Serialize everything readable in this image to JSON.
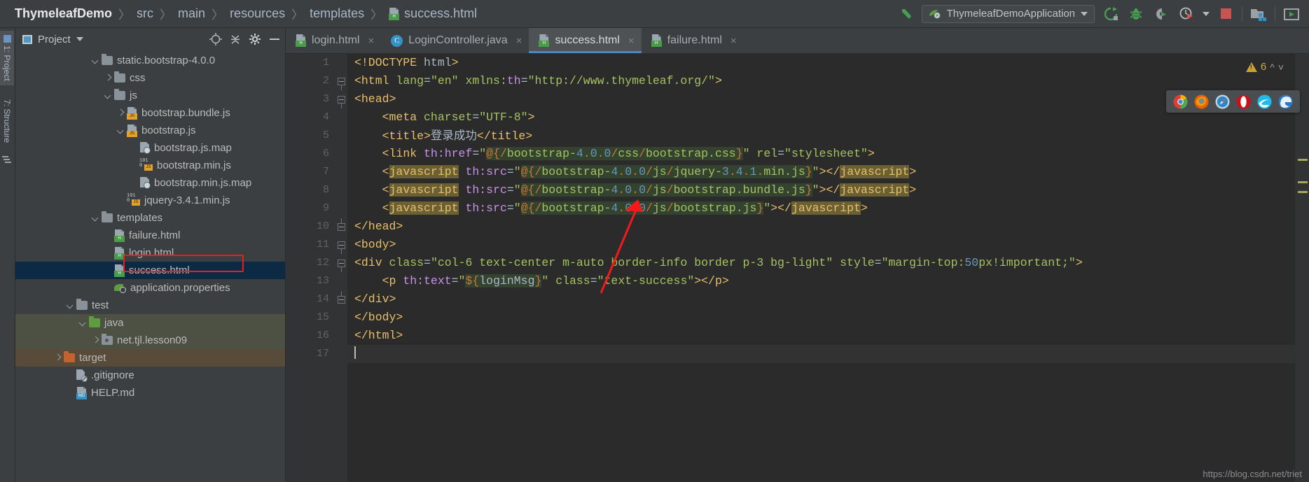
{
  "breadcrumb": {
    "project": "ThymeleafDemo",
    "items": [
      "src",
      "main",
      "resources",
      "templates"
    ],
    "file": "success.html",
    "separator": "〉"
  },
  "toolbar": {
    "back_icon": "back-arrow-icon",
    "run_config": "ThymeleafDemoApplication",
    "icons": [
      "rerun-icon",
      "debug-icon",
      "run-with-coverage-icon",
      "profiler-icon",
      "stop-icon",
      "project-structure-icon",
      "run-console-icon"
    ]
  },
  "rail": {
    "items": [
      {
        "label": "1: Project",
        "icon": "project-tool-icon",
        "selected": true
      },
      {
        "label": "7: Structure",
        "icon": "structure-tool-icon",
        "selected": false
      }
    ]
  },
  "project_panel": {
    "title": "Project",
    "tool_icons": [
      "locate-icon",
      "collapse-all-icon",
      "settings-gear-icon",
      "hide-icon"
    ],
    "tree": [
      {
        "label": "static.bootstrap-4.0.0",
        "indent": 6,
        "arrow": "down",
        "icon": "folder",
        "state": "normal"
      },
      {
        "label": "css",
        "indent": 7,
        "arrow": "right",
        "icon": "folder",
        "state": "normal"
      },
      {
        "label": "js",
        "indent": 7,
        "arrow": "down",
        "icon": "folder",
        "state": "normal"
      },
      {
        "label": "bootstrap.bundle.js",
        "indent": 8,
        "arrow": "right",
        "icon": "js-file",
        "state": "normal"
      },
      {
        "label": "bootstrap.js",
        "indent": 8,
        "arrow": "down",
        "icon": "js-file",
        "state": "normal"
      },
      {
        "label": "bootstrap.js.map",
        "indent": 9,
        "arrow": "none",
        "icon": "map-file",
        "state": "normal"
      },
      {
        "label": "bootstrap.min.js",
        "indent": 9,
        "arrow": "none",
        "icon": "min-js-file",
        "state": "normal"
      },
      {
        "label": "bootstrap.min.js.map",
        "indent": 9,
        "arrow": "none",
        "icon": "map-file",
        "state": "normal"
      },
      {
        "label": "jquery-3.4.1.min.js",
        "indent": 8,
        "arrow": "none",
        "icon": "min-js-file",
        "state": "normal"
      },
      {
        "label": "templates",
        "indent": 6,
        "arrow": "down",
        "icon": "folder",
        "state": "normal"
      },
      {
        "label": "failure.html",
        "indent": 7,
        "arrow": "none",
        "icon": "html-file",
        "state": "normal"
      },
      {
        "label": "login.html",
        "indent": 7,
        "arrow": "none",
        "icon": "html-file",
        "state": "normal"
      },
      {
        "label": "success.html",
        "indent": 7,
        "arrow": "none",
        "icon": "html-file",
        "state": "selected"
      },
      {
        "label": "application.properties",
        "indent": 7,
        "arrow": "none",
        "icon": "properties-file",
        "state": "normal"
      },
      {
        "label": "test",
        "indent": 4,
        "arrow": "down",
        "icon": "folder",
        "state": "normal"
      },
      {
        "label": "java",
        "indent": 5,
        "arrow": "down",
        "icon": "folder-green",
        "state": "test-source"
      },
      {
        "label": "net.tjl.lesson09",
        "indent": 6,
        "arrow": "right",
        "icon": "folder-package",
        "state": "test-source"
      },
      {
        "label": "target",
        "indent": 3,
        "arrow": "right",
        "icon": "folder-orange",
        "state": "excluded"
      },
      {
        "label": ".gitignore",
        "indent": 4,
        "arrow": "none",
        "icon": "gitignore-file",
        "state": "normal"
      },
      {
        "label": "HELP.md",
        "indent": 4,
        "arrow": "none",
        "icon": "md-file",
        "state": "normal"
      }
    ]
  },
  "editor": {
    "tabs": [
      {
        "label": "login.html",
        "icon": "html-file",
        "active": false
      },
      {
        "label": "LoginController.java",
        "icon": "java-class",
        "active": false
      },
      {
        "label": "success.html",
        "icon": "html-file",
        "active": true
      },
      {
        "label": "failure.html",
        "icon": "html-file",
        "active": false
      }
    ],
    "close_glyph": "×",
    "warning_count": "6",
    "line_numbers": [
      "1",
      "2",
      "3",
      "4",
      "5",
      "6",
      "7",
      "8",
      "9",
      "10",
      "11",
      "12",
      "13",
      "14",
      "15",
      "16",
      "17"
    ],
    "code_plain": [
      "<!DOCTYPE html>",
      "<html lang=\"en\" xmlns:th=\"http://www.thymeleaf.org/\">",
      "<head>",
      "    <meta charset=\"UTF-8\">",
      "    <title>登录成功</title>",
      "    <link th:href=\"@{/bootstrap-4.0.0/css/bootstrap.css}\" rel=\"stylesheet\">",
      "    <javascript th:src=\"@{/bootstrap-4.0.0/js/jquery-3.4.1.min.js}\"></javascript>",
      "    <javascript th:src=\"@{/bootstrap-4.0.0/js/bootstrap.bundle.js}\"></javascript>",
      "    <javascript th:src=\"@{/bootstrap-4.0.0/js/bootstrap.js}\"></javascript>",
      "</head>",
      "<body>",
      "<div class=\"col-6 text-center m-auto border-info border p-3 bg-light\" style=\"margin-top:50px!important;\">",
      "    <p th:text=\"${loginMsg}\" class=\"text-success\"></p>",
      "</div>",
      "</body>",
      "</html>",
      ""
    ]
  },
  "browser_popup": {
    "browsers": [
      "chrome-icon",
      "firefox-icon",
      "safari-icon",
      "opera-icon",
      "internet-explorer-icon",
      "edge-icon"
    ]
  },
  "watermark": "https://blog.csdn.net/triet",
  "colors": {
    "accent_blue": "#4a88c7",
    "selection": "#0d2a45",
    "annotation_red": "#f21b1b",
    "warning": "#c9a336",
    "stop_red": "#c75450",
    "run_green": "#499c54"
  }
}
